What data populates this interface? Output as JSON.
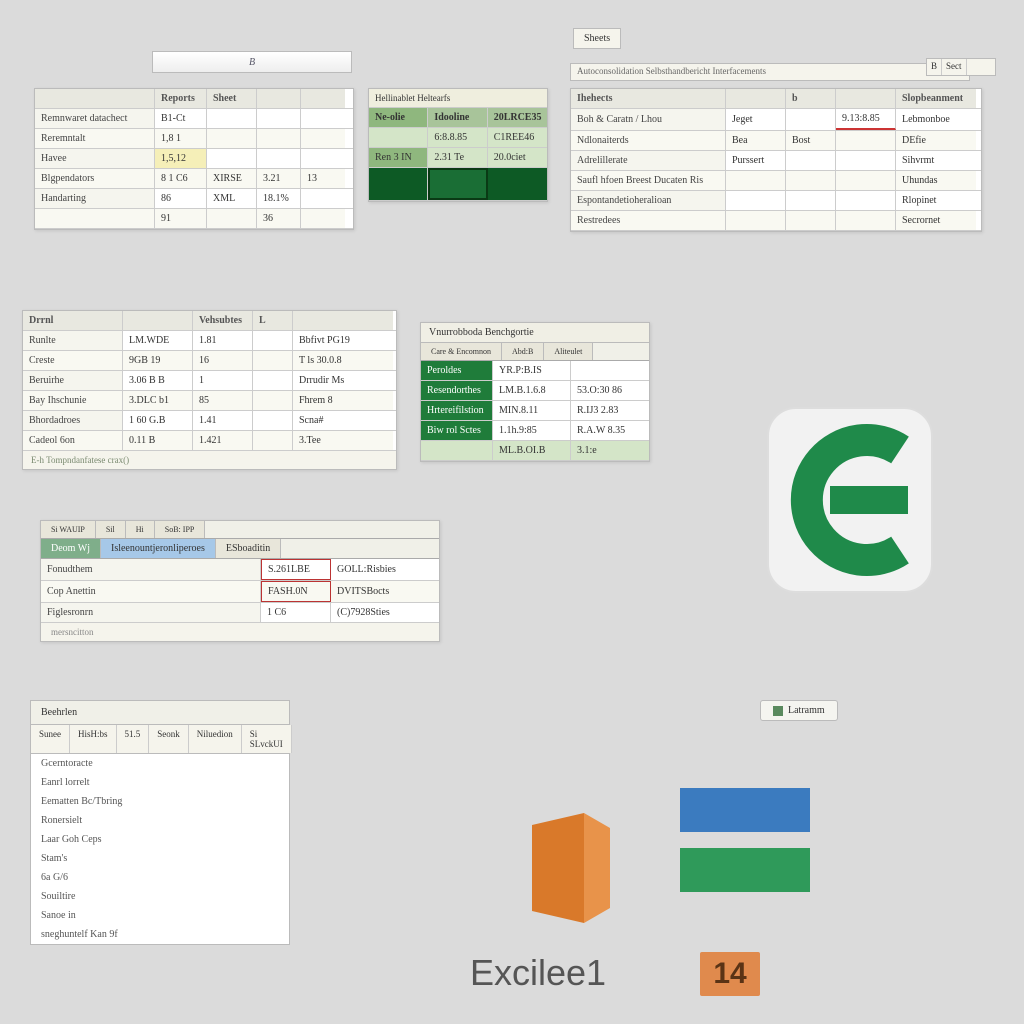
{
  "topTabs": {
    "tab1": "Sheets"
  },
  "topStrip": "B",
  "topStrip2": "Autoconsolidation Selbsthandbericht Interfacements",
  "miniBox": {
    "a": "B",
    "b": "Sect"
  },
  "panel1": {
    "headers": [
      "",
      "Reports",
      "Sheet",
      "",
      ""
    ],
    "rows": [
      {
        "label": "Remnwaret datachect",
        "c1": "B1-Ct",
        "c2": "",
        "c3": "",
        "c4": ""
      },
      {
        "label": "Reremntalt",
        "c1": "1,8 1",
        "c2": "",
        "c3": "",
        "c4": ""
      },
      {
        "label": "Havee",
        "c1": "1,5,12",
        "c2": "",
        "c3": "",
        "c4": ""
      },
      {
        "label": "Blgpendators",
        "c1": "8 1 C6",
        "c2": "XIRSE",
        "c3": "3.21",
        "c4": "13"
      },
      {
        "label": "Handarting",
        "c1": "86",
        "c2": "XML",
        "c3": "18.1%",
        "c4": ""
      },
      {
        "label": "",
        "c1": "91",
        "c2": "",
        "c3": "36",
        "c4": ""
      }
    ]
  },
  "panel2": {
    "title": "Hellinablet Heltearfs",
    "headers": [
      "Idooline",
      "20LRCE35"
    ],
    "rows": [
      {
        "a": "6:8.8.85",
        "b": "C1REE46"
      },
      {
        "a": "2.31 Te",
        "b": "20.0ciet"
      }
    ],
    "sideLabels": [
      "Ne-olie",
      "Ren 3 IN"
    ],
    "bottom": "  "
  },
  "panel3": {
    "headers": [
      "Ihehects",
      "",
      "b",
      "",
      "Slopbeanment"
    ],
    "rows": [
      {
        "label": "Boh & Caratn / Lhou",
        "c1": "Jeget",
        "c2": "",
        "c3": "9.13:8.85",
        "c4": "Lebmonboe"
      },
      {
        "label": "Ndlonaiterds",
        "c1": "Bea",
        "c2": "Bost",
        "c3": "",
        "c4": "DEfie"
      },
      {
        "label": "Adrelillerate",
        "c1": "Purssert",
        "c2": "",
        "c3": "",
        "c4": "Sihvrmt"
      },
      {
        "label": "Saufl hfoen Breest Ducaten Ris",
        "c1": "",
        "c2": "",
        "c3": "",
        "c4": "Uhundas"
      },
      {
        "label": "Espontandetioheralioan",
        "c1": "",
        "c2": "",
        "c3": "",
        "c4": "Rlopinet"
      },
      {
        "label": "Restredees",
        "c1": "",
        "c2": "",
        "c3": "",
        "c4": "Secrornet"
      }
    ]
  },
  "panel4": {
    "headers": [
      "Drrnl",
      "",
      "Vehsubtes",
      "L"
    ],
    "rows": [
      {
        "label": "Runlte",
        "c1": "LM.WDE",
        "c2": "1.81",
        "c3": "Bbfivt PG19"
      },
      {
        "label": "Creste",
        "c1": "9GB  19",
        "c2": "16",
        "c3": "T ls 30.0.8"
      },
      {
        "label": "Beruirhe",
        "c1": "3.06 B B",
        "c2": "1",
        "c3": "Drrudir  Ms"
      },
      {
        "label": "Bay Ihschunie",
        "c1": "3.DLC b1",
        "c2": "85",
        "c3": "Fhrem  8"
      },
      {
        "label": "Bhordadroes",
        "c1": "1 60 G.B",
        "c2": "1.41",
        "c3": "Scna#"
      },
      {
        "label": "Cadeol 6on",
        "c1": "0.11 B",
        "c2": "1.421",
        "c3": "3.Tee"
      }
    ],
    "footer": "E-h Tompndanfatese crax()"
  },
  "panel5": {
    "title": "Vnurrobboda Benchgortie",
    "tabs": [
      "Care & Encomnon",
      "Abd:B",
      "Aliteulet"
    ],
    "side": [
      "Peroldes",
      "Resendorthes",
      "Hrtereifilstion",
      "Biw rol Sctes"
    ],
    "cols": [
      [
        "YR.P:B.IS",
        "LM.B.1.6.8",
        "MIN.8.11",
        "1.1h.9:85"
      ],
      [
        "",
        "53.O:30 86",
        "R.IJ3 2.83",
        "R.A.W 8.35"
      ]
    ],
    "footer": [
      "ML.B.OI.B",
      "3.1:e"
    ]
  },
  "panel6": {
    "topTabs": [
      "Si WAUIP",
      "Sil",
      "Hi",
      "SoB: IPP"
    ],
    "mainTabs": [
      "Deom Wj",
      "Isleenountjeronliperoes",
      "ESboaditin"
    ],
    "rows": [
      {
        "label": "Fonudthem",
        "c1": "S.261LBE",
        "c2": "GOLL:Risbies"
      },
      {
        "label": "Cop Anettin",
        "c1": "FASH.0N",
        "c2": "DVITSBocts"
      },
      {
        "label": "Figlesronrn",
        "c1": "1  C6",
        "c2": "(C)7928Sties"
      }
    ],
    "footer": "mersncitton"
  },
  "listPanel": {
    "header": "Beehrlen",
    "tabRow": [
      "Sunee",
      "HisH:bs",
      "51.5",
      "Seonk",
      "Niluedion",
      "Si SLvckUI"
    ],
    "items": [
      "Gcerntoracte",
      "Eanrl lorrelt",
      "Eematten Bc/Tbring",
      "Ronersielt",
      "Laar Goh Ceps",
      "Stam's",
      "6a G/6",
      "Souiltire",
      "Sanoe in",
      "sneghuntelf Kan 9f"
    ]
  },
  "footerBtn": "Latramm",
  "brand": {
    "text": "Excilee1",
    "num": "14"
  }
}
